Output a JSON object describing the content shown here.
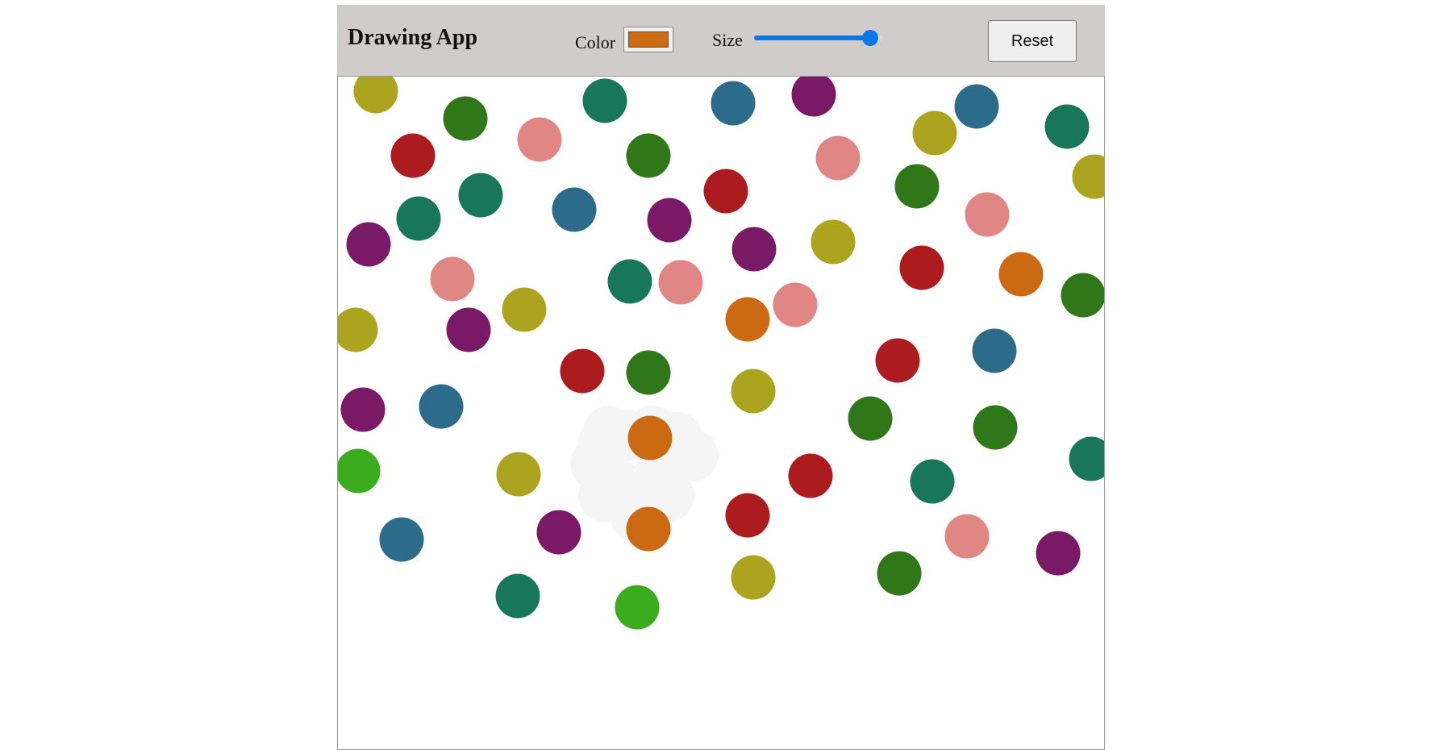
{
  "app": {
    "title": "Drawing App"
  },
  "toolbar": {
    "color_label": "Color",
    "color_value": "#cc6a14",
    "size_label": "Size",
    "size_value": 90,
    "size_min": 1,
    "size_max": 100,
    "reset_label": "Reset"
  },
  "colors": {
    "toolbar_bg": "#d0cccb",
    "accent": "#0b76e6",
    "canvas_bg": "#ffffff",
    "eraser": "#f5f5f5"
  },
  "canvas": {
    "dot_colors": {
      "olive": "#aca31e",
      "green": "#2f7719",
      "pink": "#e08786",
      "teal": "#177758",
      "blue": "#2d6b8a",
      "purple": "#7a1966",
      "red": "#ac1c1e",
      "orange": "#cc6a14",
      "lime": "#3aac1e"
    }
  }
}
